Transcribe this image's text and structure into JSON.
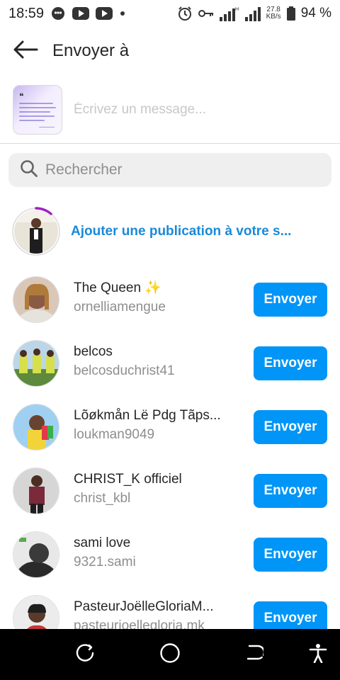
{
  "status_bar": {
    "time": "18:59",
    "speed_value": "27.8",
    "speed_unit": "KB/s",
    "battery": "94 %",
    "icons": [
      "chat-bubble-icon",
      "youtube-icon",
      "youtube-icon",
      "dot-icon",
      "alarm-icon",
      "key-icon",
      "signal-icon",
      "signal-icon",
      "battery-icon"
    ]
  },
  "header": {
    "title": "Envoyer à",
    "back_icon": "arrow-left-icon"
  },
  "composer": {
    "placeholder": "Écrivez un message...",
    "value": ""
  },
  "search": {
    "placeholder": "Rechercher",
    "icon": "search-icon"
  },
  "story": {
    "label": "Ajouter une publication à votre s..."
  },
  "contacts": [
    {
      "name": "The Queen ✨",
      "username": "ornelliamengue",
      "button": "Envoyer",
      "avatar_color": "#8a5a44"
    },
    {
      "name": "belcos",
      "username": "belcosduchrist41",
      "button": "Envoyer",
      "avatar_color": "#b7c94a"
    },
    {
      "name": "Lõøkmån Lë Pdg Tãps...",
      "username": "loukman9049",
      "button": "Envoyer",
      "avatar_color": "#6fb2e8"
    },
    {
      "name": "CHRIST_K officiel",
      "username": "christ_kbl",
      "button": "Envoyer",
      "avatar_color": "#7a2a3a"
    },
    {
      "name": "sami love",
      "username": "9321.sami",
      "button": "Envoyer",
      "avatar_color": "#3a3a3a"
    },
    {
      "name": "PasteurJoëlleGloriaM...",
      "username": "pasteurjoellegloria.mk",
      "button": "Envoyer",
      "avatar_color": "#c43a3a"
    }
  ],
  "colors": {
    "accent": "#0095f6",
    "link": "#1a8ad8",
    "story_ring": "#a020c8"
  },
  "nav": {
    "recents_icon": "recents-icon",
    "home_icon": "home-circle-icon",
    "back_icon": "nav-back-icon",
    "accessibility_icon": "accessibility-icon"
  }
}
